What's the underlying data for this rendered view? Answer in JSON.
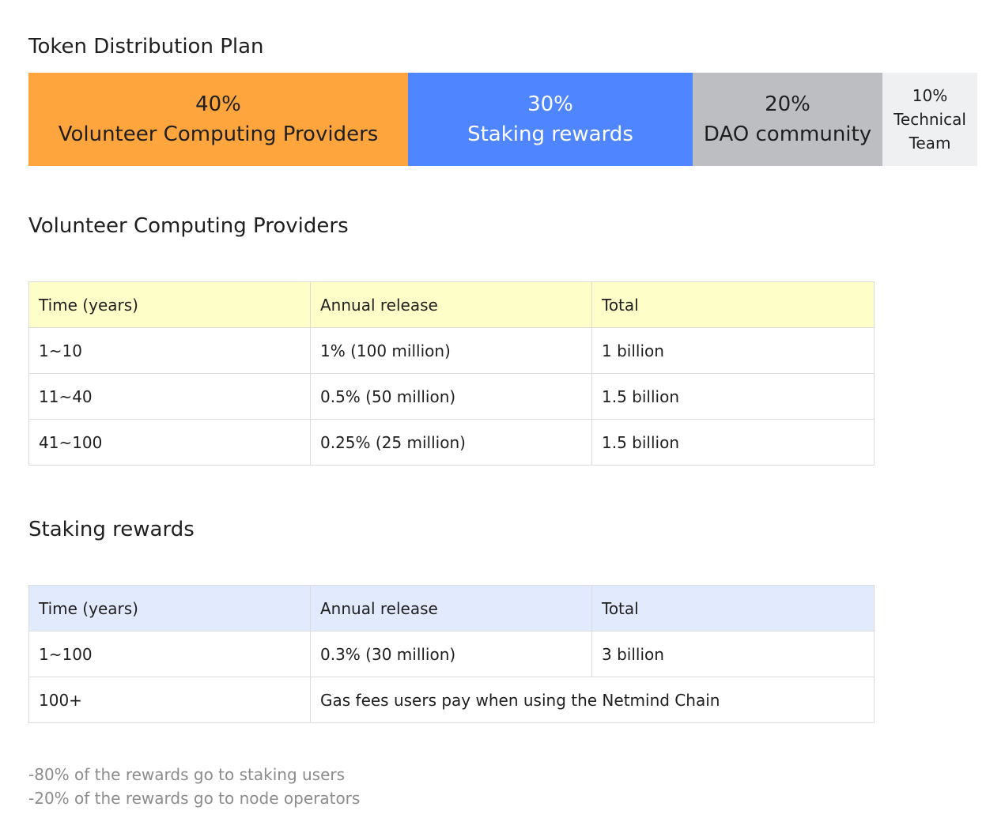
{
  "page": {
    "title": "Token Distribution Plan"
  },
  "distribution": {
    "segments": [
      {
        "percent": "40%",
        "label": "Volunteer Computing Providers",
        "share": 40,
        "color": "#ffa53d",
        "text_color": "#1f1f1f"
      },
      {
        "percent": "30%",
        "label": "Staking rewards",
        "share": 30,
        "color": "#4f86ff",
        "text_color": "#ffffff"
      },
      {
        "percent": "20%",
        "label": "DAO community",
        "share": 20,
        "color": "#bcbec2",
        "text_color": "#1f1f1f"
      },
      {
        "percent": "10%",
        "label": "Technical Team",
        "share": 10,
        "color": "#eef0f2",
        "text_color": "#1f1f1f"
      }
    ]
  },
  "volunteer_section": {
    "title": "Volunteer Computing Providers",
    "header_color": "#fefec9",
    "headers": [
      "Time (years)",
      "Annual release",
      "Total"
    ],
    "rows": [
      [
        "1~10",
        "1% (100 million)",
        "1 billion"
      ],
      [
        "11~40",
        "0.5% (50 million)",
        "1.5 billion"
      ],
      [
        "41~100",
        "0.25% (25 million)",
        "1.5 billion"
      ]
    ]
  },
  "staking_section": {
    "title": "Staking rewards",
    "header_color": "#e2eafd",
    "headers": [
      "Time (years)",
      "Annual release",
      "Total"
    ],
    "rows": [
      [
        "1~100",
        "0.3% (30 million)",
        "3 billion"
      ]
    ],
    "last_row": {
      "time": "100+",
      "description": "Gas fees users pay when using the Netmind Chain"
    }
  },
  "notes": [
    "-80% of the rewards go to staking users",
    "-20% of the rewards go to node operators"
  ]
}
